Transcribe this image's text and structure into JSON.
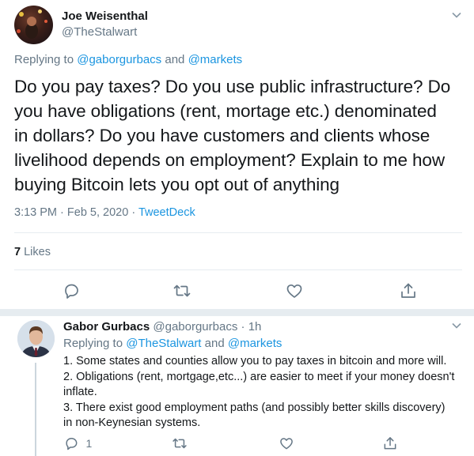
{
  "tweet": {
    "author_name": "Joe Weisenthal",
    "author_handle": "@TheStalwart",
    "replying_prefix": "Replying to",
    "replying_user1": "@gaborgurbacs",
    "replying_and": "and",
    "replying_user2": "@markets",
    "text": "Do you pay taxes? Do you use public infrastructure? Do\nyou have obligations (rent, mortage etc.) denominated\nin dollars? Do you have customers and clients whose\nlivelihood depends on employment? Explain to me how\nbuying Bitcoin lets you opt out of anything",
    "time": "3:13 PM",
    "date_sep": "·",
    "date": "Feb 5, 2020",
    "source_sep": "·",
    "source": "TweetDeck",
    "likes_count": "7",
    "likes_label": "Likes"
  },
  "reply": {
    "author_name": "Gabor Gurbacs",
    "author_handle": "@gaborgurbacs",
    "sep": "·",
    "time_ago": "1h",
    "replying_prefix": "Replying to",
    "replying_user1": "@TheStalwart",
    "replying_and": "and",
    "replying_user2": "@markets",
    "text": "1. Some states and counties allow you to pay taxes in bitcoin and more will.\n2. Obligations (rent, mortgage,etc...) are easier to meet if your money doesn't\ninflate.\n3. There exist good employment paths (and possibly better skills discovery)\nin non-Keynesian systems.",
    "reply_count": "1"
  },
  "icons": {
    "caret": "chevron-down-icon",
    "reply": "reply-icon",
    "retweet": "retweet-icon",
    "like": "heart-icon",
    "share": "share-icon"
  },
  "colors": {
    "link": "#1b95e0",
    "secondary_text": "#657786",
    "primary_text": "#14171a",
    "divider": "#e6ecf0",
    "thread_line": "#ccd6dd"
  }
}
